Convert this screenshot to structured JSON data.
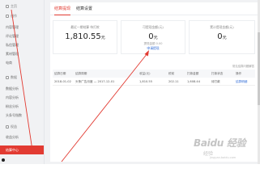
{
  "sidebar": {
    "items": [
      {
        "label": "主页",
        "kind": "sec"
      },
      {
        "label": "创作",
        "kind": "sec"
      },
      {
        "label": "内容管理",
        "kind": "sub"
      },
      {
        "label": "评论管理",
        "kind": "sub"
      },
      {
        "label": "私信管理",
        "kind": "sub"
      },
      {
        "label": "素材管理",
        "kind": "sub"
      },
      {
        "label": "电商",
        "kind": "sub"
      },
      {
        "label": "数据",
        "kind": "sec"
      },
      {
        "label": "数据分析",
        "kind": "sub"
      },
      {
        "label": "内容分析",
        "kind": "sub"
      },
      {
        "label": "粉丝分析",
        "kind": "sub"
      },
      {
        "label": "头条号指数",
        "kind": "sub"
      },
      {
        "label": "权益",
        "kind": "sec"
      },
      {
        "label": "收益分析",
        "kind": "sub"
      },
      {
        "label": "结算中心",
        "kind": "active"
      }
    ]
  },
  "tabs": [
    {
      "label": "结算提现",
      "active": true
    },
    {
      "label": "结算设置",
      "active": false
    }
  ],
  "cards": [
    {
      "label": "最近一期结算 待打款",
      "value": "1,810.55",
      "unit": "元",
      "sub": "",
      "link": ""
    },
    {
      "label": "可提现金额(元)",
      "value": "0",
      "unit": "元",
      "sub": "提现金额 0.00",
      "link": "申请提现"
    },
    {
      "label": "累计提现金额(元)",
      "value": "0",
      "unit": "元",
      "sub": "",
      "link": ""
    }
  ],
  "top_note": "常见结算问题解答",
  "table": {
    "headers": [
      "结算日期",
      "结算周期",
      "收益(元)",
      "税前",
      "打款金额",
      "打款状态",
      "操作"
    ],
    "rows": [
      [
        "2018-01-02",
        "头条广告月度 — 2017-12-01",
        "1,810.55",
        "202.11",
        "1,608.44",
        "待打款",
        "结算明细"
      ]
    ]
  },
  "watermark": {
    "logo": "Baidu 经验",
    "sub": "经验",
    "url": "jingyan.baidu.com"
  }
}
